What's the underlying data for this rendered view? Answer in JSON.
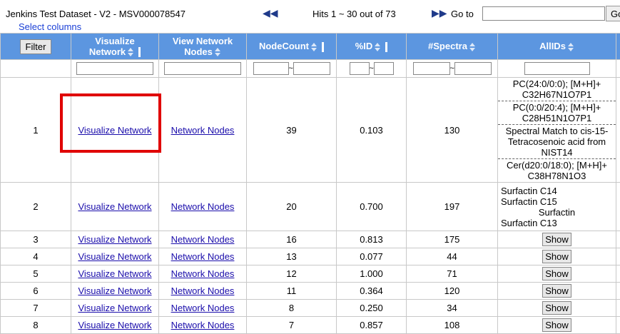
{
  "toolbar": {
    "title": "Jenkins Test Dataset - V2 - MSV000078547",
    "select_columns": "Select columns",
    "hits": "Hits 1 ~ 30 out of 73",
    "goto_label": "Go to",
    "goto_value": "",
    "go_button": "Go"
  },
  "table": {
    "filter_button": "Filter",
    "headers": {
      "visualize": "Visualize Network",
      "view": "View Network Nodes",
      "nodecount": "NodeCount",
      "pid": "%ID",
      "spectra": "#Spectra",
      "allids": "AllIDs"
    },
    "link_visualize": "Visualize Network",
    "link_nodes": "Network Nodes",
    "show_label": "Show",
    "rows": [
      {
        "idx": "1",
        "nodecount": "39",
        "pid": "0.103",
        "spectra": "130",
        "ids": [
          "PC(24:0/0:0); [M+H]+ C32H67N1O7P1",
          "PC(0:0/20:4); [M+H]+ C28H51N1O7P1",
          "Spectral Match to cis-15-Tetracosenoic acid from NIST14",
          "Cer(d20:0/18:0); [M+H]+ C38H78N1O3"
        ]
      },
      {
        "idx": "2",
        "nodecount": "20",
        "pid": "0.700",
        "spectra": "197",
        "ids": [
          "Surfactin C14",
          "Surfactin C15",
          "Surfactin",
          "Surfactin C13"
        ]
      },
      {
        "idx": "3",
        "nodecount": "16",
        "pid": "0.813",
        "spectra": "175"
      },
      {
        "idx": "4",
        "nodecount": "13",
        "pid": "0.077",
        "spectra": "44"
      },
      {
        "idx": "5",
        "nodecount": "12",
        "pid": "1.000",
        "spectra": "71"
      },
      {
        "idx": "6",
        "nodecount": "11",
        "pid": "0.364",
        "spectra": "120"
      },
      {
        "idx": "7",
        "nodecount": "8",
        "pid": "0.250",
        "spectra": "34"
      },
      {
        "idx": "8",
        "nodecount": "7",
        "pid": "0.857",
        "spectra": "108"
      }
    ]
  }
}
